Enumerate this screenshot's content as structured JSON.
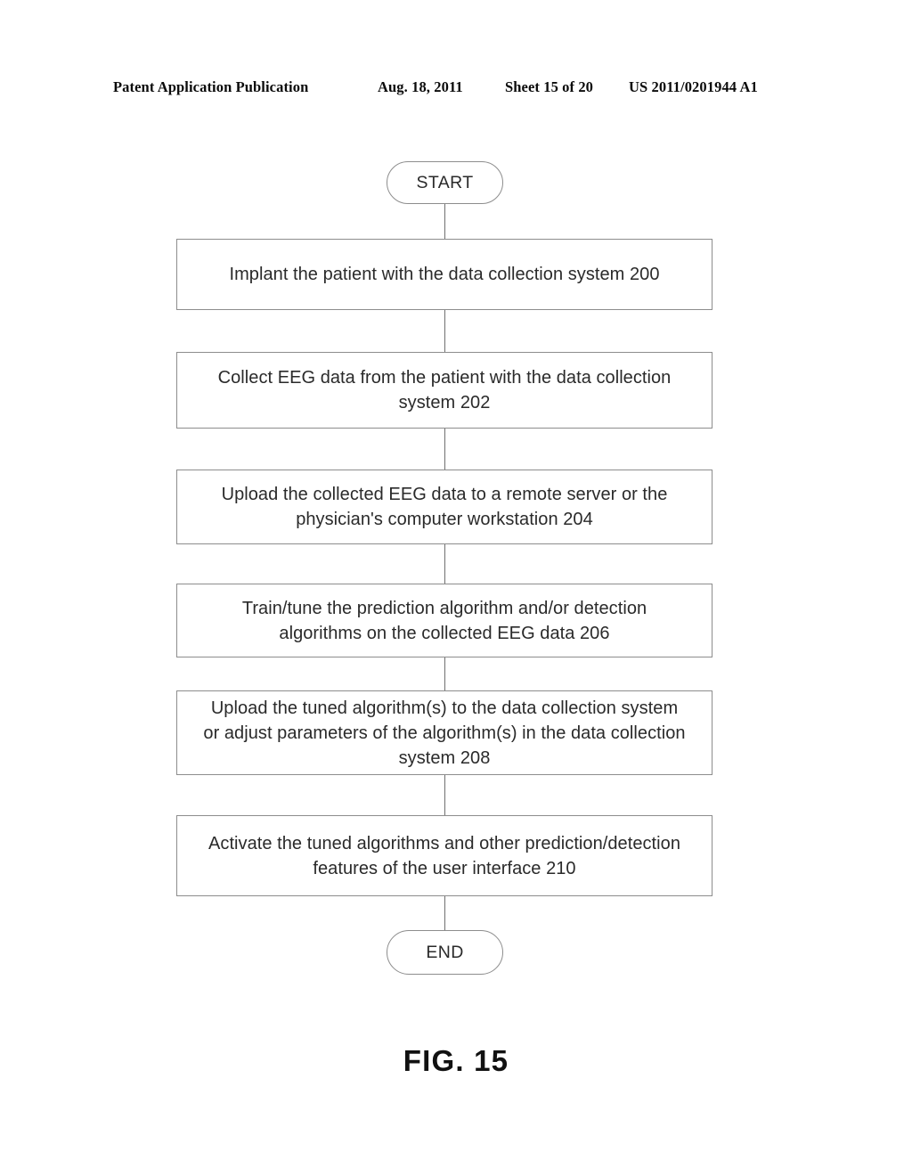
{
  "header": {
    "publication": "Patent Application Publication",
    "date": "Aug. 18, 2011",
    "sheet": "Sheet 15 of 20",
    "document_number": "US 2011/0201944 A1"
  },
  "figure": {
    "caption": "FIG. 15"
  },
  "flowchart": {
    "type": "flowchart",
    "orientation": "top-to-bottom",
    "nodes": [
      {
        "id": "start",
        "shape": "terminator",
        "label": "START"
      },
      {
        "id": "step200",
        "shape": "process",
        "ref": "200",
        "label": "Implant the patient with the data collection system 200"
      },
      {
        "id": "step202",
        "shape": "process",
        "ref": "202",
        "label": "Collect EEG data from the patient with the data collection\nsystem 202"
      },
      {
        "id": "step204",
        "shape": "process",
        "ref": "204",
        "label": "Upload the collected EEG data to a remote server or the\nphysician's computer workstation 204"
      },
      {
        "id": "step206",
        "shape": "process",
        "ref": "206",
        "label": "Train/tune the prediction algorithm and/or detection\nalgorithms on the collected EEG data 206"
      },
      {
        "id": "step208",
        "shape": "process",
        "ref": "208",
        "label": "Upload the tuned algorithm(s) to the data collection system\nor adjust parameters of the algorithm(s) in the data collection\nsystem 208"
      },
      {
        "id": "step210",
        "shape": "process",
        "ref": "210",
        "label": "Activate the tuned algorithms and other prediction/detection\nfeatures of the user interface 210"
      },
      {
        "id": "end",
        "shape": "terminator",
        "label": "END"
      }
    ],
    "edges": [
      {
        "from": "start",
        "to": "step200"
      },
      {
        "from": "step200",
        "to": "step202"
      },
      {
        "from": "step202",
        "to": "step204"
      },
      {
        "from": "step204",
        "to": "step206"
      },
      {
        "from": "step206",
        "to": "step208"
      },
      {
        "from": "step208",
        "to": "step210"
      },
      {
        "from": "step210",
        "to": "end"
      }
    ],
    "colors": {
      "border": "#8d8d8d",
      "text": "#2a2a2a",
      "connector": "#6f6f6f",
      "background": "#ffffff"
    }
  }
}
